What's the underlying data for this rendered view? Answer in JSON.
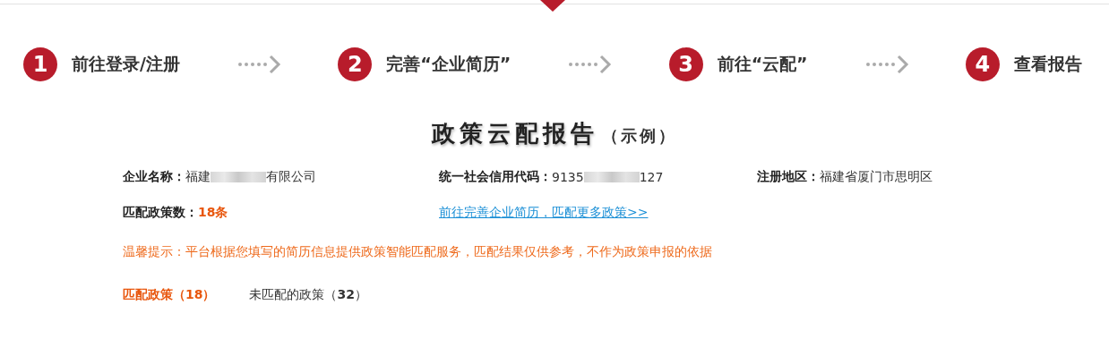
{
  "steps": [
    {
      "number": "1",
      "label": "前往登录/注册"
    },
    {
      "number": "2",
      "label": "完善“企业简历”"
    },
    {
      "number": "3",
      "label": "前往“云配”"
    },
    {
      "number": "4",
      "label": "查看报告"
    }
  ],
  "report": {
    "title": "政策云配报告",
    "subtitle": "（示例）"
  },
  "info": [
    {
      "label": "企业名称：",
      "value_start": "福建",
      "value_end": "有限公司",
      "redacted": true
    },
    {
      "label": "统一社会信用代码：",
      "value_start": "9135",
      "value_end": "127",
      "redacted": true
    },
    {
      "label": "注册地区：",
      "value_start": "福建省厦门市思明区",
      "redacted": false
    }
  ],
  "match_count": {
    "label": "匹配政策数：",
    "value": "18条"
  },
  "improve_link": "前往完善企业简历，匹配更多政策>>",
  "notice": "温馨提示：平台根据您填写的简历信息提供政策智能匹配服务，匹配结果仅供参考，不作为政策申报的依据",
  "tabs": [
    {
      "label": "匹配政策（18）",
      "selected": true
    },
    {
      "label": "未匹配的政策（**32**）",
      "selected": false
    }
  ]
}
